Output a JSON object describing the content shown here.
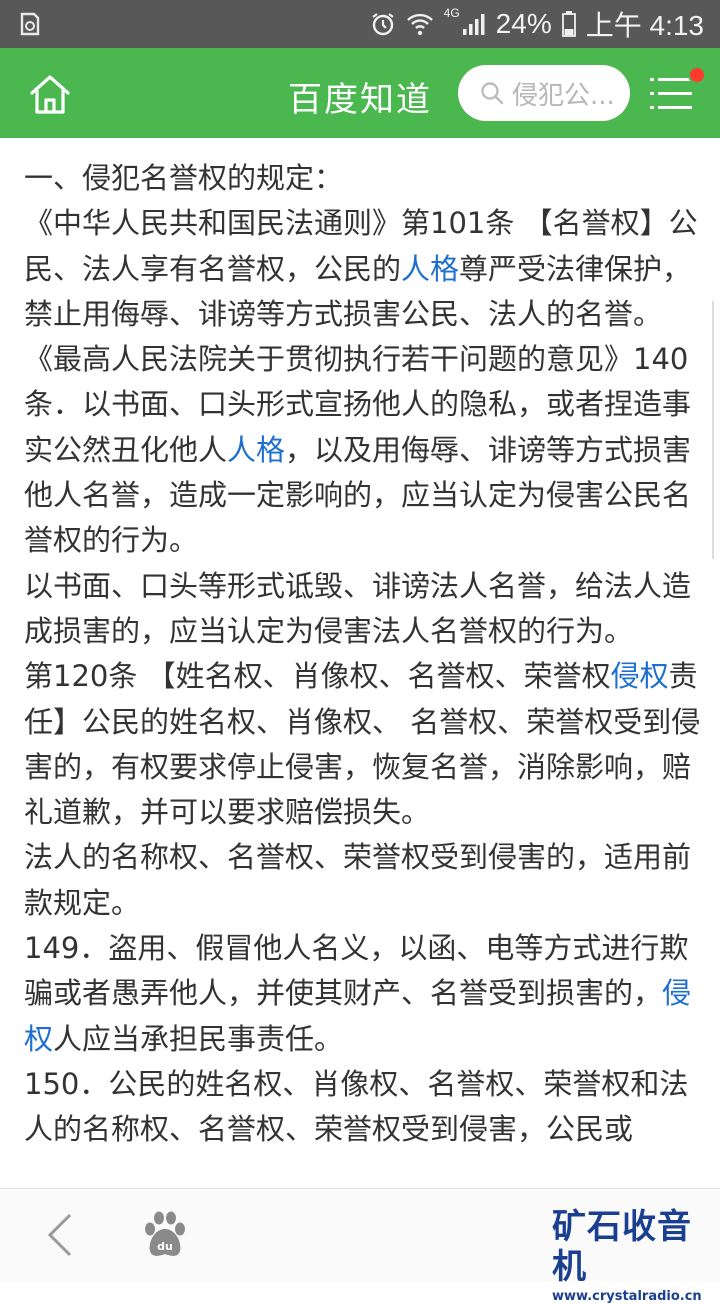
{
  "status_bar": {
    "network": "4G",
    "battery": "24%",
    "time": "上午 4:13"
  },
  "header": {
    "title": "百度知道",
    "search_placeholder": "侵犯公...",
    "icons": [
      "home-icon",
      "search-icon",
      "menu-icon"
    ],
    "accent_color": "#4bb74f",
    "notification_color": "#ff3b30"
  },
  "article": {
    "link_color": "#1e6fd0",
    "lines": [
      {
        "segments": [
          {
            "text": "一、侵犯名誉权的规定："
          }
        ]
      },
      {
        "segments": [
          {
            "text": "《中华人民共和国民法通则》第101条 【名誉权】公民、法人享有名誉权，公民的"
          },
          {
            "text": "人格",
            "link": true
          },
          {
            "text": "尊严受法律保护，禁止用侮辱、诽谤等方式损害公民、法人的名誉。"
          }
        ]
      },
      {
        "segments": [
          {
            "text": "《最高人民法院关于贯彻执行若干问题的意见》140条．以书面、口头形式宣扬他人的隐私，或者捏造事实公然丑化他人"
          },
          {
            "text": "人格",
            "link": true
          },
          {
            "text": "，以及用侮辱、诽谤等方式损害他人名誉，造成一定影响的，应当认定为侵害公民名誉权的行为。"
          }
        ]
      },
      {
        "segments": [
          {
            "text": "以书面、口头等形式诋毁、诽谤法人名誉，给法人造成损害的，应当认定为侵害法人名誉权的行为。"
          }
        ]
      },
      {
        "segments": [
          {
            "text": "第120条 【姓名权、肖像权、名誉权、荣誉权"
          },
          {
            "text": "侵权",
            "link": true
          },
          {
            "text": "责任】公民的姓名权、肖像权、 名誉权、荣誉权受到侵害的，有权要求停止侵害，恢复名誉，消除影响，赔礼道歉，并可以要求赔偿损失。"
          }
        ]
      },
      {
        "segments": [
          {
            "text": "法人的名称权、名誉权、荣誉权受到侵害的，适用前款规定。"
          }
        ]
      },
      {
        "segments": [
          {
            "text": "149．盗用、假冒他人名义，以函、电等方式进行欺骗或者愚弄他人，并使其财产、名誉受到损害的，"
          },
          {
            "text": "侵权",
            "link": true
          },
          {
            "text": "人应当承担民事责任。"
          }
        ]
      },
      {
        "segments": [
          {
            "text": "150．公民的姓名权、肖像权、名誉权、荣誉权和法人的名称权、名誉权、荣誉权受到侵害，公民或"
          }
        ]
      }
    ]
  },
  "bottom_bar": {
    "icons": [
      "back-icon",
      "baidu-paw-icon"
    ],
    "paw_label": "du",
    "watermark_title": "矿石收音机",
    "watermark_url": "www.crystalradio.cn"
  }
}
